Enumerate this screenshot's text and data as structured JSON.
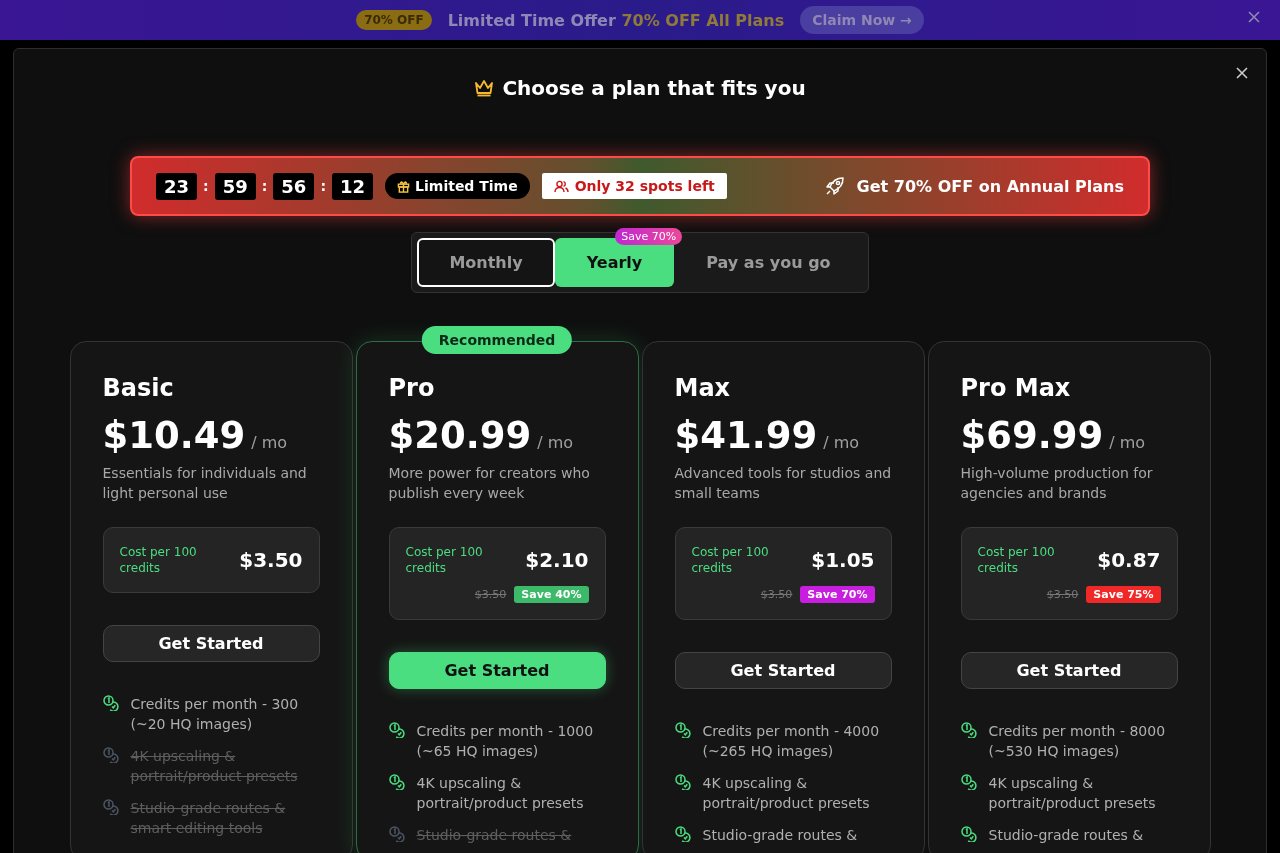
{
  "promo_bar": {
    "badge": "70% OFF",
    "text": "Limited Time Offer",
    "highlight": "70% OFF All Plans",
    "button": "Claim Now →"
  },
  "modal": {
    "title": "Choose a plan that fits you"
  },
  "countdown": {
    "timer": [
      {
        "kind": "digit",
        "text": "23"
      },
      {
        "kind": "sep",
        "text": ":"
      },
      {
        "kind": "digit",
        "text": "59"
      },
      {
        "kind": "sep",
        "text": ":"
      },
      {
        "kind": "digit",
        "text": "56"
      },
      {
        "kind": "sep",
        "text": ":"
      },
      {
        "kind": "digit",
        "text": "12"
      }
    ],
    "limited_badge": "Limited Time",
    "spots_badge": "Only 32 spots left",
    "offer": "Get 70% OFF on Annual Plans"
  },
  "billing_tabs": [
    {
      "label": "Monthly",
      "selected": false,
      "focused": true
    },
    {
      "label": "Yearly",
      "selected": true,
      "focused": false,
      "badge": "Save 70%"
    },
    {
      "label": "Pay as you go",
      "selected": false,
      "focused": false
    }
  ],
  "plans": [
    {
      "name": "Basic",
      "price": "$10.49",
      "period": "/ mo",
      "description": "Essentials for individuals and light personal use",
      "cost_label": "Cost per 100 credits",
      "cost": "$3.50",
      "highlighted": false,
      "button": {
        "label": "Get Started",
        "primary": false
      },
      "features": [
        {
          "text": "Credits per month - 300 (~20 HQ images)",
          "included": true
        },
        {
          "text": "4K upscaling & portrait/product presets",
          "included": false
        },
        {
          "text": "Studio-grade routes & smart editing tools",
          "included": false
        }
      ]
    },
    {
      "name": "Pro",
      "price": "$20.99",
      "period": "/ mo",
      "badge": "Recommended",
      "description": "More power for creators who publish every week",
      "cost_label": "Cost per 100 credits",
      "cost": "$2.10",
      "original": "$3.50",
      "save": "Save 40%",
      "color": "#3cba6a",
      "highlighted": true,
      "button": {
        "label": "Get Started",
        "primary": true
      },
      "features": [
        {
          "text": "Credits per month - 1000 (~65 HQ images)",
          "included": true
        },
        {
          "text": "4K upscaling & portrait/product presets",
          "included": true
        },
        {
          "text": "Studio-grade routes &",
          "included": false
        }
      ]
    },
    {
      "name": "Max",
      "price": "$41.99",
      "period": "/ mo",
      "description": "Advanced tools for studios and small teams",
      "cost_label": "Cost per 100 credits",
      "cost": "$1.05",
      "original": "$3.50",
      "save": "Save 70%",
      "color": "#c81ee0",
      "highlighted": false,
      "button": {
        "label": "Get Started",
        "primary": false
      },
      "features": [
        {
          "text": "Credits per month - 4000 (~265 HQ images)",
          "included": true
        },
        {
          "text": "4K upscaling & portrait/product presets",
          "included": true
        },
        {
          "text": "Studio-grade routes &",
          "included": true
        }
      ]
    },
    {
      "name": "Pro Max",
      "price": "$69.99",
      "period": "/ mo",
      "description": "High-volume production for agencies and brands",
      "cost_label": "Cost per 100 credits",
      "cost": "$0.87",
      "original": "$3.50",
      "save": "Save 75%",
      "color": "#f02828",
      "highlighted": false,
      "button": {
        "label": "Get Started",
        "primary": false
      },
      "features": [
        {
          "text": "Credits per month - 8000 (~530 HQ images)",
          "included": true
        },
        {
          "text": "4K upscaling & portrait/product presets",
          "included": true
        },
        {
          "text": "Studio-grade routes &",
          "included": true
        }
      ]
    }
  ]
}
